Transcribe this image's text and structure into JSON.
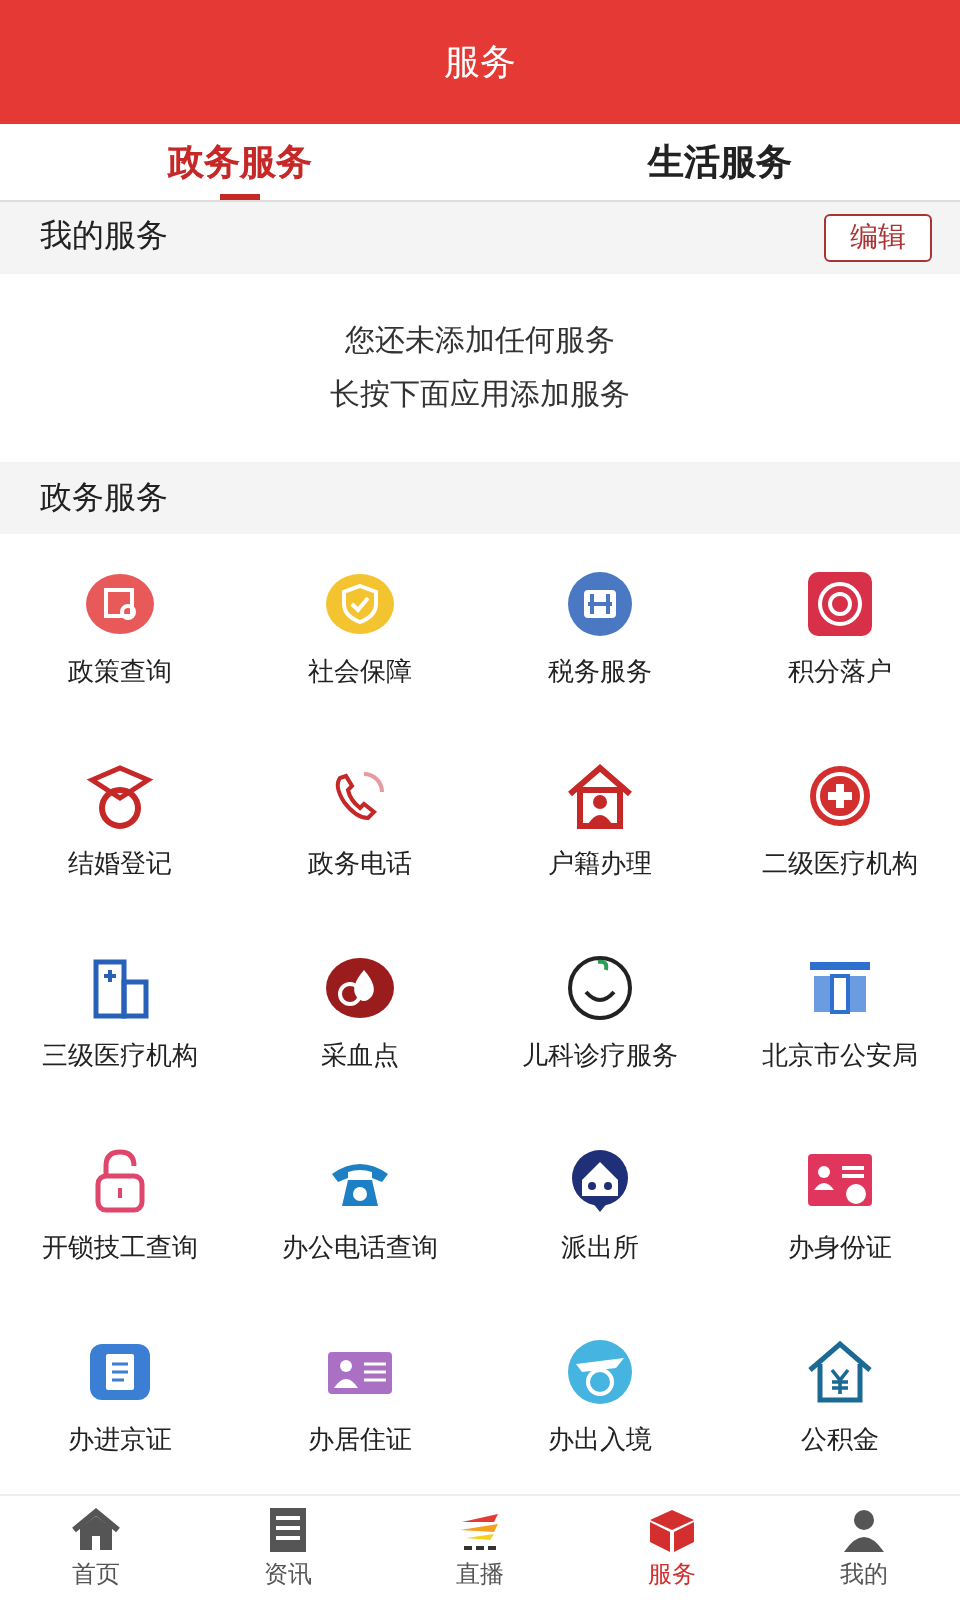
{
  "header": {
    "title": "服务"
  },
  "tabs": [
    {
      "label": "政务服务",
      "selected": true
    },
    {
      "label": "生活服务",
      "selected": false
    }
  ],
  "my_services": {
    "title": "我的服务",
    "edit_button": "编辑",
    "empty_lines": [
      "您还未添加任何服务",
      "长按下面应用添加服务"
    ]
  },
  "services": {
    "title": "政务服务",
    "items": [
      {
        "label": "政策查询",
        "kind": "policy"
      },
      {
        "label": "社会保障",
        "kind": "shield"
      },
      {
        "label": "税务服务",
        "kind": "tax"
      },
      {
        "label": "积分落户",
        "kind": "points"
      },
      {
        "label": "结婚登记",
        "kind": "ring"
      },
      {
        "label": "政务电话",
        "kind": "phone"
      },
      {
        "label": "户籍办理",
        "kind": "house"
      },
      {
        "label": "二级医疗机构",
        "kind": "cross"
      },
      {
        "label": "三级医疗机构",
        "kind": "hospital"
      },
      {
        "label": "采血点",
        "kind": "blood"
      },
      {
        "label": "儿科诊疗服务",
        "kind": "baby"
      },
      {
        "label": "北京市公安局",
        "kind": "building"
      },
      {
        "label": "开锁技工查询",
        "kind": "lock"
      },
      {
        "label": "办公电话查询",
        "kind": "telephone"
      },
      {
        "label": "派出所",
        "kind": "station"
      },
      {
        "label": "办身份证",
        "kind": "idcard"
      },
      {
        "label": "办进京证",
        "kind": "document"
      },
      {
        "label": "办居住证",
        "kind": "residence"
      },
      {
        "label": "办出入境",
        "kind": "plane"
      },
      {
        "label": "公积金",
        "kind": "fund"
      }
    ]
  },
  "bottom_nav": [
    {
      "label": "首页",
      "kind": "home",
      "selected": false
    },
    {
      "label": "资讯",
      "kind": "news",
      "selected": false
    },
    {
      "label": "直播",
      "kind": "live",
      "selected": false
    },
    {
      "label": "服务",
      "kind": "service",
      "selected": true
    },
    {
      "label": "我的",
      "kind": "me",
      "selected": false
    }
  ]
}
